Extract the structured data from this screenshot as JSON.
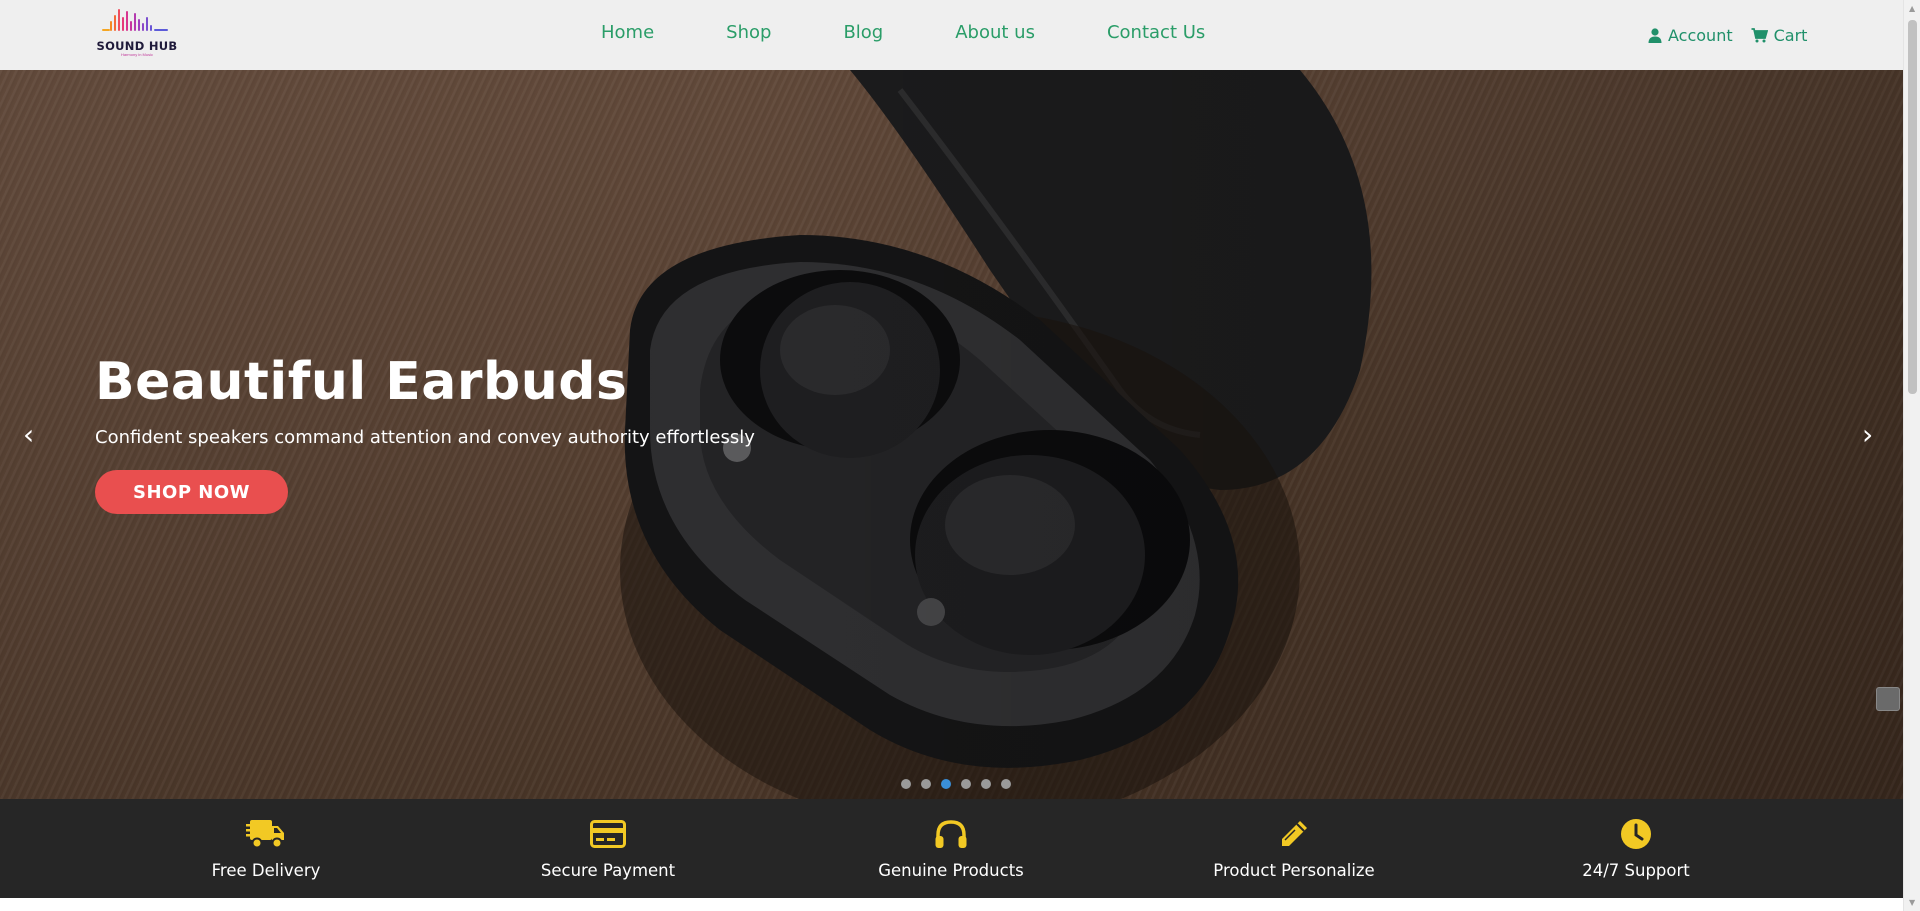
{
  "logo": {
    "name": "SOUND HUB",
    "tagline": "Harmony in Music"
  },
  "nav": [
    "Home",
    "Shop",
    "Blog",
    "About us",
    "Contact Us"
  ],
  "header_tools": {
    "account": "Account",
    "cart": "Cart"
  },
  "hero": {
    "title": "Beautiful Earbuds",
    "subtitle": "Confident speakers command attention and convey authority effortlessly",
    "cta": "SHOP NOW",
    "prev_arrow": "‹",
    "next_arrow": "›",
    "slide_count": 6,
    "active_slide": 3
  },
  "features": [
    {
      "label": "Free Delivery",
      "icon": "truck-icon"
    },
    {
      "label": "Secure Payment",
      "icon": "credit-card-icon"
    },
    {
      "label": "Genuine Products",
      "icon": "headphones-icon"
    },
    {
      "label": "Product Personalize",
      "icon": "pencil-icon"
    },
    {
      "label": "24/7 Support",
      "icon": "clock-icon"
    }
  ],
  "colors": {
    "nav_text": "#2a9d68",
    "cta_bg": "#e94f4f",
    "feature_bar_bg": "#262626",
    "feature_icon": "#f2c924",
    "active_dot": "#3a8fd8"
  }
}
